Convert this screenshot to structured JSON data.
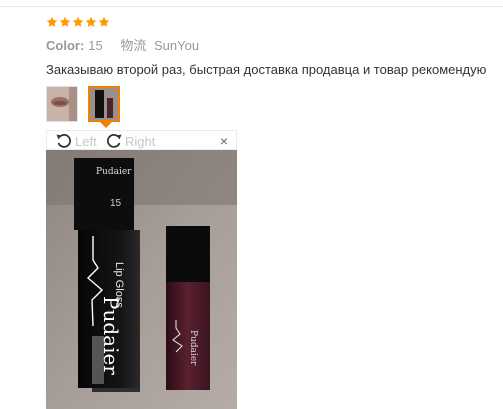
{
  "rating": {
    "stars": 5,
    "max": 5,
    "color": "#ff9900"
  },
  "spec": {
    "color_label": "Color:",
    "color_value": "15",
    "logistics_label": "物流",
    "logistics_value": "SunYou"
  },
  "review": {
    "text": "Заказываю второй раз, быстрая доставка продавца и товар рекомендую"
  },
  "viewer": {
    "rotate_left_label": "Left",
    "rotate_right_label": "Right",
    "close_glyph": "×",
    "selected_thumb": 2
  },
  "photo_text": {
    "brand_top": "Pudaier",
    "shade": "15",
    "box_product": "Lip Gloss",
    "box_brand": "Pudaier",
    "tube_brand": "Pudaier"
  }
}
